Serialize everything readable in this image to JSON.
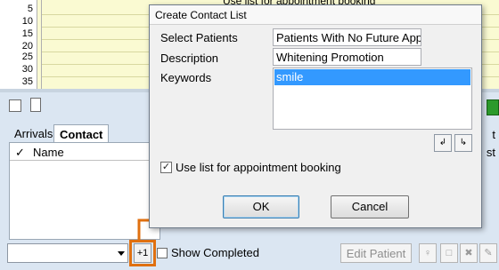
{
  "background": {
    "time_labels": [
      "5",
      "10",
      "15",
      "20",
      "25",
      "30",
      "35"
    ],
    "top_checkbox_label": "Use list for appointment booking",
    "tabs": [
      {
        "label": "Arrivals"
      },
      {
        "label": "Contact Lists"
      }
    ],
    "list_columns": [
      "✓",
      "Name"
    ],
    "right_col_headers": [
      "t",
      "st"
    ],
    "combo_value": "",
    "plus_one_label": "+1",
    "show_completed_label": "Show Completed",
    "edit_patient_label": "Edit Patient"
  },
  "dialog": {
    "title": "Create Contact List",
    "select_patients_label": "Select Patients",
    "select_patients_value": "Patients With No Future Appo",
    "description_label": "Description",
    "description_value": "Whitening Promotion",
    "keywords_label": "Keywords",
    "keywords": [
      "smile"
    ],
    "use_list_label": "Use list for appointment booking",
    "use_list_checked": true,
    "ok_label": "OK",
    "cancel_label": "Cancel"
  },
  "colors": {
    "schedule_bg": "#fafad2",
    "highlight_orange": "#e07010",
    "selection_blue": "#3399ff"
  }
}
